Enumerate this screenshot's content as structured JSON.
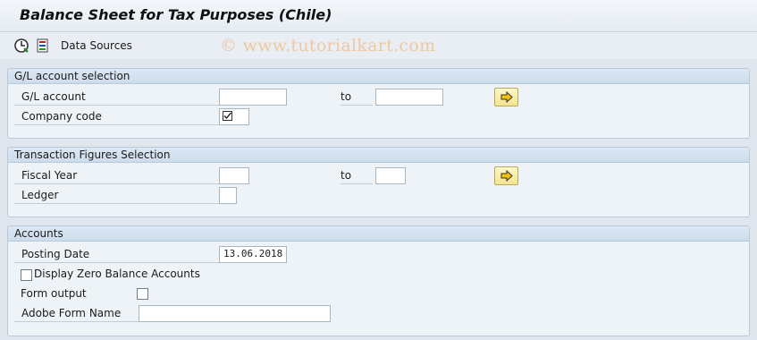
{
  "window": {
    "title": "Balance Sheet for Tax Purposes (Chile)"
  },
  "toolbar": {
    "execute_icon": "clock-execute-icon",
    "variant_icon": "selection-options-icon",
    "data_sources_label": "Data Sources",
    "watermark": "© www.tutorialkart.com"
  },
  "gl_selection": {
    "header": "G/L account selection",
    "gl_account_label": "G/L account",
    "gl_account_from": "",
    "gl_account_to": "",
    "to_label": "to",
    "company_code_label": "Company code",
    "company_code_value": "",
    "company_code_has_match_icon": true
  },
  "trans_selection": {
    "header": "Transaction Figures Selection",
    "fiscal_year_label": "Fiscal Year",
    "fiscal_year_from": "",
    "fiscal_year_to": "",
    "to_label": "to",
    "ledger_label": "Ledger",
    "ledger_value": ""
  },
  "accounts": {
    "header": "Accounts",
    "posting_date_label": "Posting Date",
    "posting_date_value": "13.06.2018",
    "zero_balance_label": "Display Zero Balance Accounts",
    "zero_balance_checked": false,
    "form_output_label": "Form output",
    "form_output_checked": false,
    "adobe_form_label": "Adobe Form Name",
    "adobe_form_value": ""
  },
  "colors": {
    "background": "#dfe6ee",
    "group_header": "#cddcec",
    "multi_select_button": "#f3e38f"
  }
}
